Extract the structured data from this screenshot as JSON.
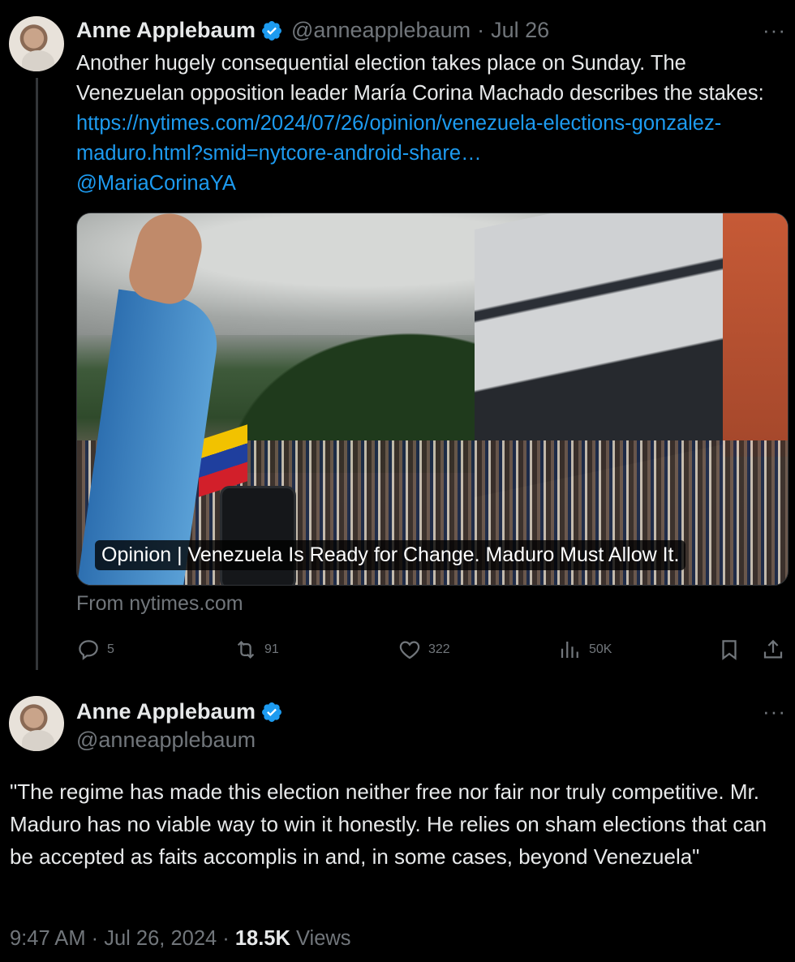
{
  "tweet1": {
    "display_name": "Anne Applebaum",
    "handle": "@anneapplebaum",
    "separator": "·",
    "date": "Jul 26",
    "more": "···",
    "text_intro": "Another hugely consequential election takes place on Sunday. The Venezuelan opposition leader María Corina Machado describes the stakes: ",
    "link_text": "https://nytimes.com/2024/07/26/opinion/venezuela-elections-gonzalez-maduro.html?smid=nytcore-android-share…",
    "mention": "@MariaCorinaYA",
    "card": {
      "title": "Opinion | Venezuela Is Ready for Change. Maduro Must Allow It.",
      "source": "From nytimes.com"
    },
    "actions": {
      "replies": "5",
      "reposts": "91",
      "likes": "322",
      "views": "50K"
    }
  },
  "tweet2": {
    "display_name": "Anne Applebaum",
    "handle": "@anneapplebaum",
    "more": "···",
    "text": "\"The regime has made this election neither free nor fair nor truly competitive. Mr. Maduro has no viable way to win it honestly. He relies on sham elections that can be accepted as faits accomplis in and, in some cases, beyond Venezuela\"",
    "time": "9:47 AM",
    "sep1": " · ",
    "date": "Jul 26, 2024",
    "sep2": " · ",
    "views_count": "18.5K",
    "views_label": "Views"
  },
  "colors": {
    "background": "#000000",
    "text": "#e7e9ea",
    "secondary": "#71767b",
    "link": "#1d9bf0",
    "verified": "#1d9bf0"
  }
}
